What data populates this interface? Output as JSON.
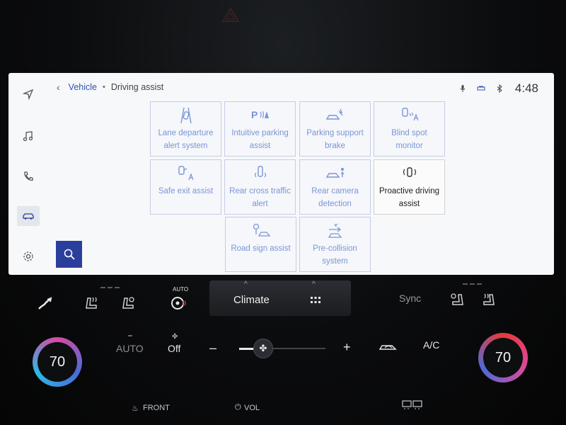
{
  "breadcrumb": {
    "back": "‹",
    "parent": "Vehicle",
    "separator": "•",
    "current": "Driving assist"
  },
  "status": {
    "clock": "4:48"
  },
  "rail": [
    {
      "icon": "navigation-icon"
    },
    {
      "icon": "music-icon"
    },
    {
      "icon": "phone-icon"
    },
    {
      "icon": "car-icon",
      "active": true
    },
    {
      "icon": "settings-icon"
    }
  ],
  "tiles": [
    {
      "label": "Lane departure alert system",
      "icon": "lane-departure-icon",
      "enabled": false
    },
    {
      "label": "Intuitive parking assist",
      "icon": "parking-sensor-icon",
      "enabled": false
    },
    {
      "label": "Parking support brake",
      "icon": "parking-brake-icon",
      "enabled": false
    },
    {
      "label": "Blind spot monitor",
      "icon": "blind-spot-icon",
      "enabled": false
    },
    {
      "label": "Safe exit assist",
      "icon": "safe-exit-icon",
      "enabled": false
    },
    {
      "label": "Rear cross traffic alert",
      "icon": "rear-cross-traffic-icon",
      "enabled": false
    },
    {
      "label": "Rear camera detection",
      "icon": "rear-camera-icon",
      "enabled": false
    },
    {
      "label": "Proactive driving assist",
      "icon": "proactive-driving-icon",
      "enabled": true
    },
    {
      "label": "Road sign assist",
      "icon": "road-sign-icon",
      "enabled": false
    },
    {
      "label": "Pre-collision system",
      "icon": "pre-collision-icon",
      "enabled": false
    }
  ],
  "climate": {
    "auto_heat_label": "AUTO",
    "center_label": "Climate",
    "sync_label": "Sync",
    "auto_label": "AUTO",
    "off_label": "Off",
    "minus_label": "–",
    "plus_label": "+",
    "ac_label": "A/C",
    "left_temp": "70",
    "right_temp": "70",
    "front_label": "FRONT",
    "vol_label": "VOL",
    "fan_level": 0.2
  },
  "colors": {
    "accent": "#2f55b7",
    "tile_border": "#c5cde6",
    "tile_text": "#7b95d4",
    "search_bg": "#2a3e9c"
  }
}
